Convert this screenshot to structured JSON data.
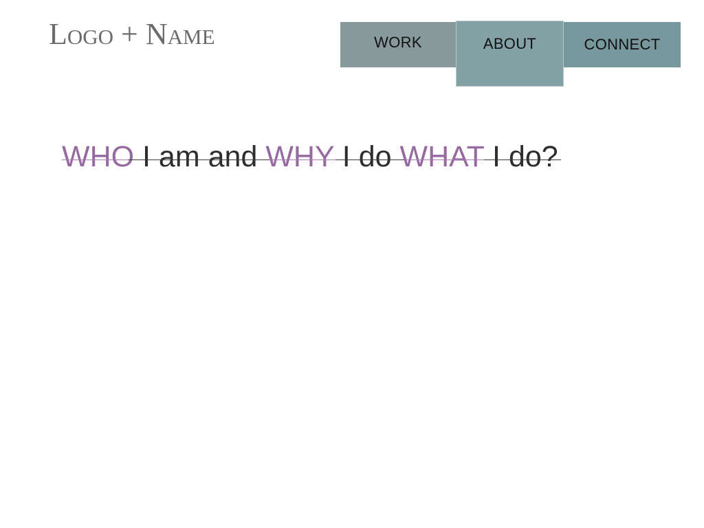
{
  "header": {
    "logo_text": "Logo + Name"
  },
  "nav": {
    "items": [
      {
        "label": "WORK"
      },
      {
        "label": "ABOUT"
      },
      {
        "label": "CONNECT"
      }
    ],
    "active": "ABOUT"
  },
  "main": {
    "headline": {
      "word_who": "WHO",
      "text_i_am_and": " I am and ",
      "word_why": "WHY",
      "text_i_do_1": " I do ",
      "word_what": "WHAT",
      "text_i_do_2": " I do?"
    }
  },
  "colors": {
    "accent_purple": "#966aa0",
    "nav_work": "#88999b",
    "nav_about": "#84a1a6",
    "nav_connect": "#76979c",
    "text_dark": "#2d2d2d",
    "logo_gray": "#6b6b6b"
  }
}
